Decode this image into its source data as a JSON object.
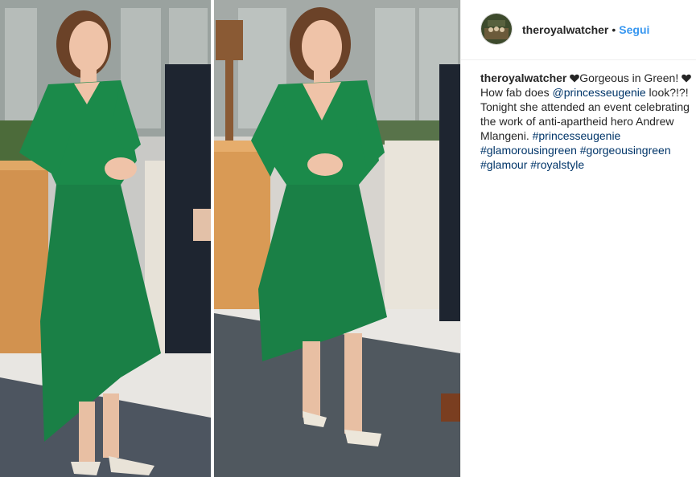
{
  "header": {
    "username": "theroyalwatcher",
    "separator": "•",
    "follow_label": "Segui"
  },
  "caption": {
    "username": "theroyalwatcher",
    "text1": "Gorgeous in Green! ",
    "text2": "How fab does ",
    "mention": "@princesseugenie",
    "text3": " look?!?! Tonight she attended an event celebrating the work of anti-apartheid hero Andrew Mlangeni. ",
    "hashtags": [
      "#princesseugenie",
      "#glamorousingreen",
      "#gorgeousingreen",
      "#glamour",
      "#royalstyle"
    ]
  },
  "icons": {
    "heart_color": "#262626"
  },
  "colors": {
    "dress_green": "#1b8a4a",
    "link_blue": "#3897f0",
    "hashtag_blue": "#003569"
  }
}
